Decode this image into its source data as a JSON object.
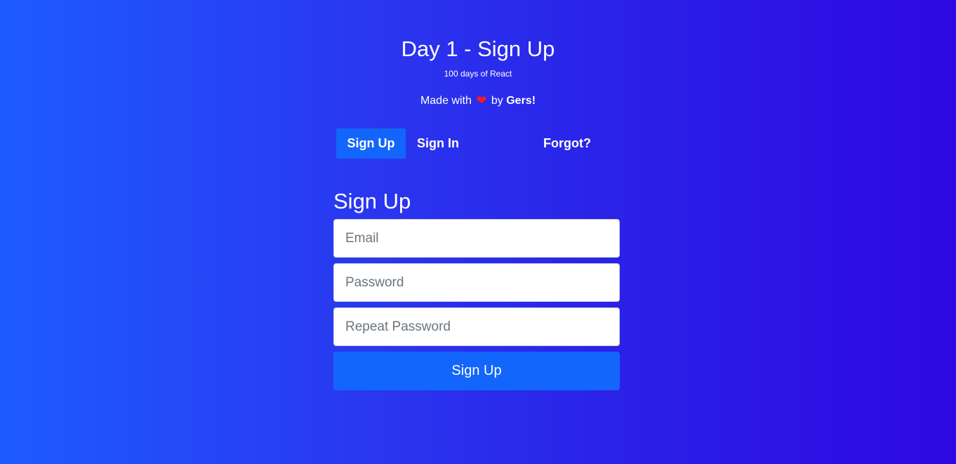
{
  "header": {
    "title": "Day 1 - Sign Up",
    "subtitle": "100 days of React",
    "made_with_prefix": "Made with",
    "heart_icon": "heart-icon",
    "made_with_by": "by",
    "author": "Gers!"
  },
  "tabs": [
    {
      "label": "Sign Up",
      "active": true
    },
    {
      "label": "Sign In",
      "active": false
    },
    {
      "label": "Forgot?",
      "active": false
    }
  ],
  "form": {
    "title": "Sign Up",
    "email_placeholder": "Email",
    "email_value": "",
    "password_placeholder": "Password",
    "password_value": "",
    "repeat_password_placeholder": "Repeat Password",
    "repeat_password_value": "",
    "submit_label": "Sign Up"
  },
  "colors": {
    "gradient_start": "#1e5bff",
    "gradient_end": "#2e08e2",
    "accent": "#1366fb",
    "heart": "#ff1a1a"
  }
}
